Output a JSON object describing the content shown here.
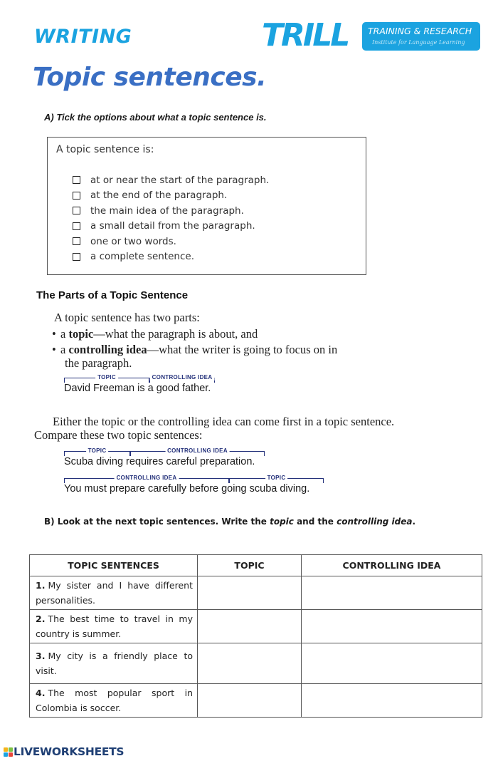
{
  "header": {
    "subject": "WRITING",
    "title": "Topic sentences.",
    "logo": {
      "word": "TRILL",
      "badge_line1": "TRAINING & RESEARCH",
      "badge_line2": "Institute for Language Learning",
      "color": "#1ba3e0"
    }
  },
  "section_a": {
    "instruction": "A)  Tick the options about what a topic sentence is.",
    "box_title": "A topic sentence is:",
    "options": [
      {
        "label": "at or near the start of the paragraph.",
        "checked": false
      },
      {
        "label": "at the end of the paragraph.",
        "checked": false
      },
      {
        "label": "the main idea of the paragraph.",
        "checked": false
      },
      {
        "label": "a small detail from the paragraph.",
        "checked": false
      },
      {
        "label": "one or two words.",
        "checked": false
      },
      {
        "label": "a complete sentence.",
        "checked": false
      }
    ]
  },
  "parts": {
    "heading": "The Parts of a Topic Sentence",
    "intro": "A topic sentence has two parts:",
    "bullet1": {
      "pre": "a ",
      "bold": "topic",
      "post": "—what the paragraph is about, and"
    },
    "bullet2": {
      "pre": "a ",
      "bold": "controlling idea",
      "post": "—what the writer is going to focus on in",
      "cont": "the paragraph."
    },
    "example1": {
      "part1": "David Freeman",
      "part2": " is a good father.",
      "label1": "TOPIC",
      "label2": "CONTROLLING IDEA"
    },
    "either": "Either the topic or the controlling idea can come first in a topic sentence.",
    "compare": "Compare these two topic sentences:",
    "example2": {
      "part1": "Scuba diving",
      "part2": " requires careful preparation.",
      "label1": "TOPIC",
      "label2": "CONTROLLING IDEA"
    },
    "example3": {
      "part1": "You must prepare carefully before",
      "part2": " going scuba diving.",
      "label1": "CONTROLLING IDEA",
      "label2": "TOPIC"
    }
  },
  "section_b": {
    "instruction_pre": "B)  Look at the next topic sentences. Write the ",
    "instruction_topic": "topic",
    "instruction_mid": " and the ",
    "instruction_idea": "controlling idea",
    "instruction_end": ".",
    "columns": [
      "TOPIC SENTENCES",
      "TOPIC",
      "CONTROLLING IDEA"
    ],
    "rows": [
      {
        "num": "1.",
        "sentence": "My sister and I have different personalities.",
        "topic": "",
        "controlling_idea": ""
      },
      {
        "num": "2.",
        "sentence": "The best time to travel in my country is summer.",
        "topic": "",
        "controlling_idea": ""
      },
      {
        "num": "3.",
        "sentence": "My city is a friendly place to visit.",
        "topic": "",
        "controlling_idea": ""
      },
      {
        "num": "4.",
        "sentence": "The most popular sport in Colombia is soccer.",
        "topic": "",
        "controlling_idea": ""
      }
    ]
  },
  "footer": {
    "brand": "LIVEWORKSHEETS",
    "icon_letters": [
      "L",
      "I",
      "V",
      "E"
    ],
    "icon_colors": [
      "#f4b41a",
      "#7cc242",
      "#1ba3e0",
      "#e8463a"
    ]
  }
}
